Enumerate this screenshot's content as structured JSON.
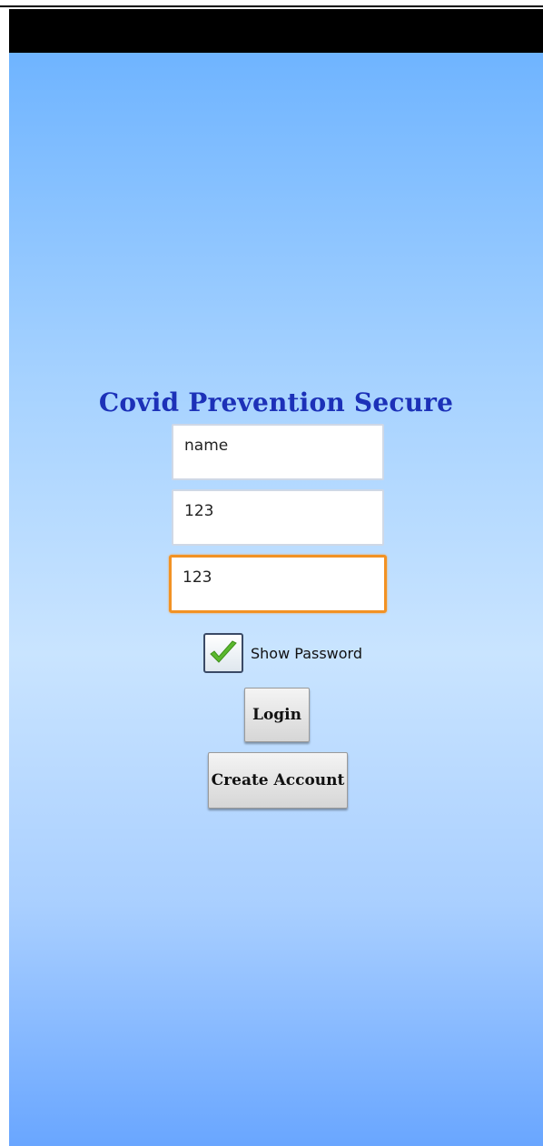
{
  "app": {
    "title": "Covid Prevention Secure"
  },
  "form": {
    "username_value": "name",
    "password_value": "123",
    "confirm_value": "123",
    "show_password_label": "Show Password",
    "show_password_checked": true
  },
  "buttons": {
    "login_label": "Login",
    "create_account_label": "Create Account"
  },
  "colors": {
    "title": "#1c31b8",
    "focus_border": "#f29224",
    "check": "#5ab82e"
  }
}
